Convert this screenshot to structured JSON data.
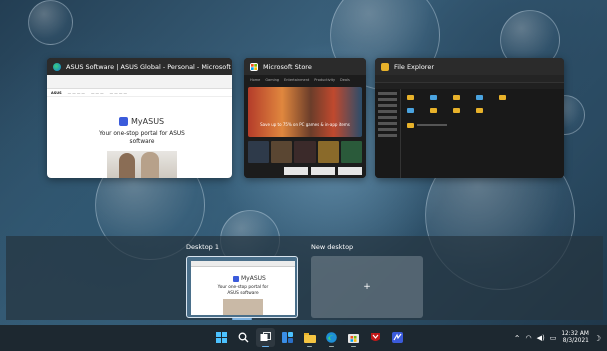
{
  "windows": {
    "edge": {
      "title": "ASUS Software | ASUS Global - Personal - Microsoft Edge",
      "page": {
        "logo_text": "MyASUS",
        "tagline": "Your one-stop portal for ASUS software"
      }
    },
    "store": {
      "title": "Microsoft Store",
      "hero_text": "Save up to 75% on PC games & in-app items"
    },
    "explorer": {
      "title": "File Explorer"
    }
  },
  "desktops": {
    "desktop1_label": "Desktop 1",
    "new_desktop_label": "New desktop",
    "new_desktop_symbol": "+",
    "thumb_logo": "MyASUS",
    "thumb_tagline": "Your one-stop portal for ASUS software"
  },
  "taskbar": {
    "apps": [
      "start-icon",
      "search-icon",
      "task-view-icon",
      "widgets-icon",
      "file-explorer-icon",
      "edge-icon",
      "store-icon",
      "mcafee-icon",
      "myasus-icon"
    ],
    "time": "12:32 AM",
    "date": "8/3/2021"
  },
  "colors": {
    "accent": "#6cb4ee",
    "taskbar": "#1d2830"
  }
}
